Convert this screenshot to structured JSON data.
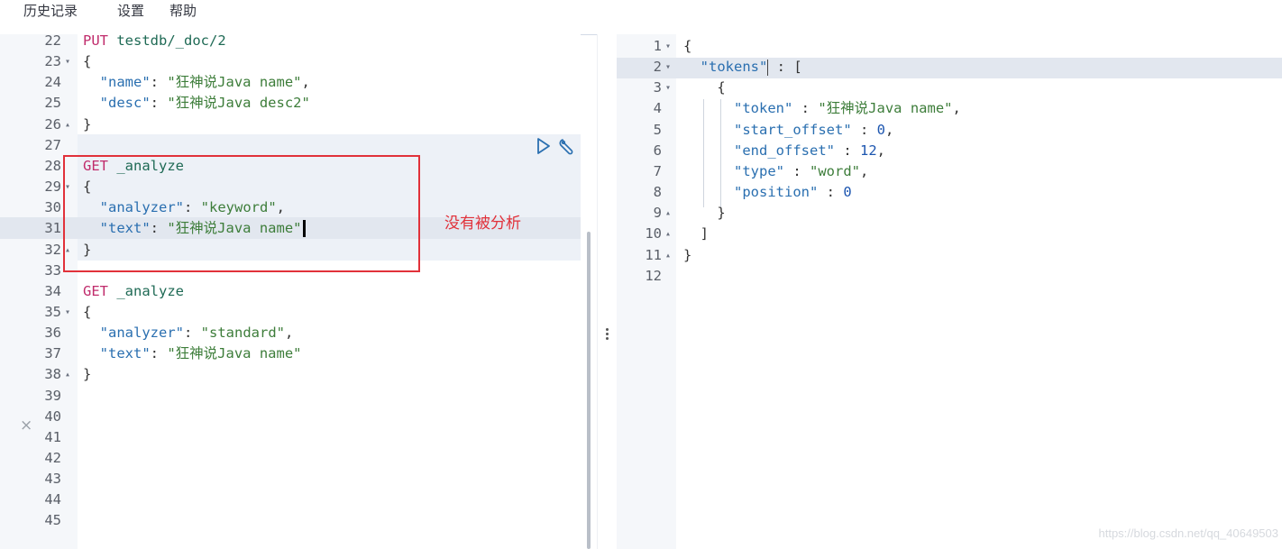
{
  "menu": {
    "history": "历史记录",
    "settings": "设置",
    "help": "帮助"
  },
  "request_editor": {
    "lines": [
      {
        "num": "22",
        "fold": "",
        "tokens": [
          {
            "t": "PUT",
            "c": "method"
          },
          {
            "t": " ",
            "c": "punc"
          },
          {
            "t": "testdb/_doc/2",
            "c": "url"
          }
        ]
      },
      {
        "num": "23",
        "fold": "▾",
        "tokens": [
          {
            "t": "{",
            "c": "punc"
          }
        ]
      },
      {
        "num": "24",
        "fold": "",
        "tokens": [
          {
            "t": "  ",
            "c": "punc"
          },
          {
            "t": "\"name\"",
            "c": "key"
          },
          {
            "t": ": ",
            "c": "punc"
          },
          {
            "t": "\"狂神说Java name\"",
            "c": "str"
          },
          {
            "t": ",",
            "c": "punc"
          }
        ]
      },
      {
        "num": "25",
        "fold": "",
        "tokens": [
          {
            "t": "  ",
            "c": "punc"
          },
          {
            "t": "\"desc\"",
            "c": "key"
          },
          {
            "t": ": ",
            "c": "punc"
          },
          {
            "t": "\"狂神说Java desc2\"",
            "c": "str"
          }
        ]
      },
      {
        "num": "26",
        "fold": "▴",
        "tokens": [
          {
            "t": "}",
            "c": "punc"
          }
        ]
      },
      {
        "num": "27",
        "fold": "",
        "tokens": []
      },
      {
        "num": "28",
        "fold": "",
        "tokens": [
          {
            "t": "GET",
            "c": "method"
          },
          {
            "t": " ",
            "c": "punc"
          },
          {
            "t": "_analyze",
            "c": "url"
          }
        ]
      },
      {
        "num": "29",
        "fold": "▾",
        "tokens": [
          {
            "t": "{",
            "c": "punc"
          }
        ]
      },
      {
        "num": "30",
        "fold": "",
        "tokens": [
          {
            "t": "  ",
            "c": "punc"
          },
          {
            "t": "\"analyzer\"",
            "c": "key"
          },
          {
            "t": ": ",
            "c": "punc"
          },
          {
            "t": "\"keyword\"",
            "c": "str"
          },
          {
            "t": ",",
            "c": "punc"
          }
        ]
      },
      {
        "num": "31",
        "fold": "",
        "cursor": true,
        "tokens": [
          {
            "t": "  ",
            "c": "punc"
          },
          {
            "t": "\"text\"",
            "c": "key"
          },
          {
            "t": ": ",
            "c": "punc"
          },
          {
            "t": "\"狂神说Java name\"",
            "c": "str"
          }
        ]
      },
      {
        "num": "32",
        "fold": "▴",
        "tokens": [
          {
            "t": "}",
            "c": "punc"
          }
        ]
      },
      {
        "num": "33",
        "fold": "",
        "tokens": []
      },
      {
        "num": "34",
        "fold": "",
        "tokens": [
          {
            "t": "GET",
            "c": "method"
          },
          {
            "t": " ",
            "c": "punc"
          },
          {
            "t": "_analyze",
            "c": "url"
          }
        ]
      },
      {
        "num": "35",
        "fold": "▾",
        "tokens": [
          {
            "t": "{",
            "c": "punc"
          }
        ]
      },
      {
        "num": "36",
        "fold": "",
        "tokens": [
          {
            "t": "  ",
            "c": "punc"
          },
          {
            "t": "\"analyzer\"",
            "c": "key"
          },
          {
            "t": ": ",
            "c": "punc"
          },
          {
            "t": "\"standard\"",
            "c": "str"
          },
          {
            "t": ",",
            "c": "punc"
          }
        ]
      },
      {
        "num": "37",
        "fold": "",
        "tokens": [
          {
            "t": "  ",
            "c": "punc"
          },
          {
            "t": "\"text\"",
            "c": "key"
          },
          {
            "t": ": ",
            "c": "punc"
          },
          {
            "t": "\"狂神说Java name\"",
            "c": "str"
          }
        ]
      },
      {
        "num": "38",
        "fold": "▴",
        "tokens": [
          {
            "t": "}",
            "c": "punc"
          }
        ]
      },
      {
        "num": "39",
        "fold": "",
        "tokens": []
      },
      {
        "num": "40",
        "fold": "",
        "tokens": []
      },
      {
        "num": "41",
        "fold": "",
        "tokens": []
      },
      {
        "num": "42",
        "fold": "",
        "tokens": []
      },
      {
        "num": "43",
        "fold": "",
        "tokens": []
      },
      {
        "num": "44",
        "fold": "",
        "tokens": []
      },
      {
        "num": "45",
        "fold": "",
        "tokens": []
      }
    ]
  },
  "response_editor": {
    "lines": [
      {
        "num": "1",
        "fold": "▾",
        "tokens": [
          {
            "t": "{",
            "c": "punc"
          }
        ]
      },
      {
        "num": "2",
        "fold": "▾",
        "tokens": [
          {
            "t": "  ",
            "c": "punc"
          },
          {
            "t": "\"tokens\"",
            "c": "key",
            "cursor": true
          },
          {
            "t": " : [",
            "c": "punc"
          }
        ]
      },
      {
        "num": "3",
        "fold": "▾",
        "tokens": [
          {
            "t": "    {",
            "c": "punc"
          }
        ]
      },
      {
        "num": "4",
        "fold": "",
        "tokens": [
          {
            "t": "      ",
            "c": "punc"
          },
          {
            "t": "\"token\"",
            "c": "key"
          },
          {
            "t": " : ",
            "c": "punc"
          },
          {
            "t": "\"狂神说Java name\"",
            "c": "str"
          },
          {
            "t": ",",
            "c": "punc"
          }
        ]
      },
      {
        "num": "5",
        "fold": "",
        "tokens": [
          {
            "t": "      ",
            "c": "punc"
          },
          {
            "t": "\"start_offset\"",
            "c": "key"
          },
          {
            "t": " : ",
            "c": "punc"
          },
          {
            "t": "0",
            "c": "num"
          },
          {
            "t": ",",
            "c": "punc"
          }
        ]
      },
      {
        "num": "6",
        "fold": "",
        "tokens": [
          {
            "t": "      ",
            "c": "punc"
          },
          {
            "t": "\"end_offset\"",
            "c": "key"
          },
          {
            "t": " : ",
            "c": "punc"
          },
          {
            "t": "12",
            "c": "num"
          },
          {
            "t": ",",
            "c": "punc"
          }
        ]
      },
      {
        "num": "7",
        "fold": "",
        "tokens": [
          {
            "t": "      ",
            "c": "punc"
          },
          {
            "t": "\"type\"",
            "c": "key"
          },
          {
            "t": " : ",
            "c": "punc"
          },
          {
            "t": "\"word\"",
            "c": "str"
          },
          {
            "t": ",",
            "c": "punc"
          }
        ]
      },
      {
        "num": "8",
        "fold": "",
        "tokens": [
          {
            "t": "      ",
            "c": "punc"
          },
          {
            "t": "\"position\"",
            "c": "key"
          },
          {
            "t": " : ",
            "c": "punc"
          },
          {
            "t": "0",
            "c": "num"
          }
        ]
      },
      {
        "num": "9",
        "fold": "▴",
        "tokens": [
          {
            "t": "    }",
            "c": "punc"
          }
        ]
      },
      {
        "num": "10",
        "fold": "▴",
        "tokens": [
          {
            "t": "  ]",
            "c": "punc"
          }
        ]
      },
      {
        "num": "11",
        "fold": "▴",
        "tokens": [
          {
            "t": "}",
            "c": "punc"
          }
        ]
      },
      {
        "num": "12",
        "fold": "",
        "tokens": []
      }
    ]
  },
  "annotation": {
    "text": "没有被分析",
    "color": "#e1313a"
  },
  "watermark": "https://blog.csdn.net/qq_40649503",
  "colors": {
    "method": "#c02c6c",
    "key": "#2a6fb0",
    "string": "#3d7d3a",
    "number": "#1d56b0",
    "gutter": "#f5f7fa"
  }
}
